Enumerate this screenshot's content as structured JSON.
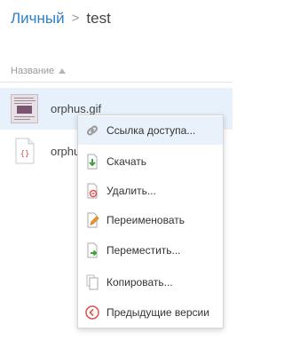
{
  "breadcrumb": {
    "root": "Личный",
    "current": "test"
  },
  "file_list": {
    "column_header": "Название",
    "sort": "ascending",
    "files": [
      {
        "name": "orphus.gif",
        "selected": true
      },
      {
        "name": "orphu"
      }
    ]
  },
  "context_menu": {
    "items": [
      {
        "label": "Ссылка доступа...",
        "icon": "link-icon",
        "highlighted": true
      },
      {
        "label": "Скачать",
        "icon": "download-icon"
      },
      {
        "label": "Удалить...",
        "icon": "delete-icon"
      },
      {
        "label": "Переименовать",
        "icon": "rename-icon"
      },
      {
        "label": "Переместить...",
        "icon": "move-icon"
      },
      {
        "label": "Копировать...",
        "icon": "copy-icon"
      },
      {
        "label": "Предыдущие версии",
        "icon": "history-icon"
      }
    ]
  },
  "colors": {
    "accent": "#2e7fc9",
    "selection": "#e7f1fb",
    "menu_highlight": "#e9f1fa"
  }
}
